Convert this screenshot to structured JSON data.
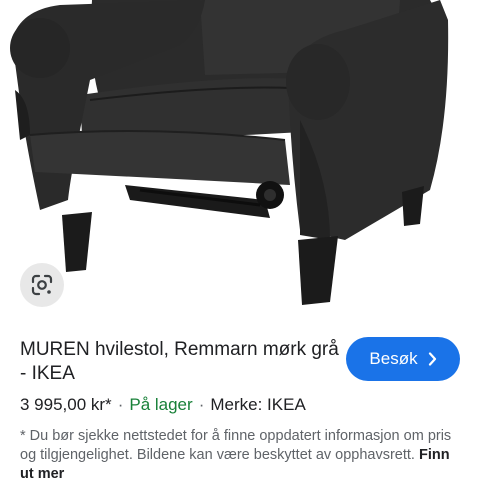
{
  "product": {
    "title": "MUREN hvilestol, Remmarn mørk grå - IKEA",
    "price": "3 995,00 kr*",
    "separator": "·",
    "availability": "På lager",
    "brand": "Merke: IKEA",
    "image_alt": "MUREN hvilestol"
  },
  "actions": {
    "visit_label": "Besøk",
    "visit_icon": "chevron-right-icon",
    "lens_icon": "google-lens-icon"
  },
  "disclaimer": {
    "text": "* Du bør sjekke nettstedet for å finne oppdatert informasjon om pris og tilgjengelighet. Bildene kan være beskyttet av opphavsrett.",
    "link": "Finn ut mer"
  },
  "colors": {
    "accent": "#1a73e8",
    "stock": "#188038",
    "chair": "#2b2b2b"
  }
}
